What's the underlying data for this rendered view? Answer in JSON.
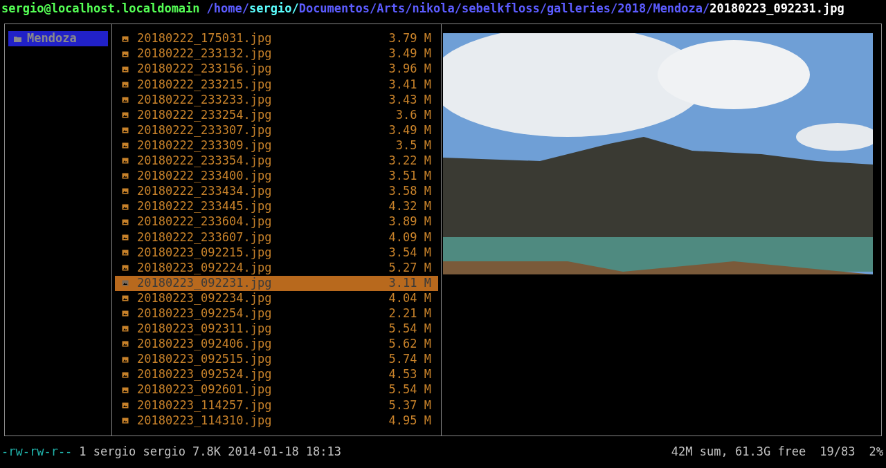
{
  "title_bar": {
    "user_host": "sergio@localhost.localdomain",
    "path": [
      {
        "kind": "dir",
        "text": "/home/"
      },
      {
        "kind": "home",
        "text": "sergio/"
      },
      {
        "kind": "dir",
        "text": "Documentos/Arts/nikola/sebelkfloss/galleries/2018/Mendoza/"
      },
      {
        "kind": "file",
        "text": "20180223_092231.jpg"
      }
    ]
  },
  "parent_column": {
    "items": [
      {
        "name": "Mendoza",
        "selected": true
      }
    ]
  },
  "file_list": {
    "items": [
      {
        "name": "20180222_175031.jpg",
        "size": "3.79 M",
        "selected": false
      },
      {
        "name": "20180222_233132.jpg",
        "size": "3.49 M",
        "selected": false
      },
      {
        "name": "20180222_233156.jpg",
        "size": "3.96 M",
        "selected": false
      },
      {
        "name": "20180222_233215.jpg",
        "size": "3.41 M",
        "selected": false
      },
      {
        "name": "20180222_233233.jpg",
        "size": "3.43 M",
        "selected": false
      },
      {
        "name": "20180222_233254.jpg",
        "size": "3.6 M",
        "selected": false
      },
      {
        "name": "20180222_233307.jpg",
        "size": "3.49 M",
        "selected": false
      },
      {
        "name": "20180222_233309.jpg",
        "size": "3.5 M",
        "selected": false
      },
      {
        "name": "20180222_233354.jpg",
        "size": "3.22 M",
        "selected": false
      },
      {
        "name": "20180222_233400.jpg",
        "size": "3.51 M",
        "selected": false
      },
      {
        "name": "20180222_233434.jpg",
        "size": "3.58 M",
        "selected": false
      },
      {
        "name": "20180222_233445.jpg",
        "size": "4.32 M",
        "selected": false
      },
      {
        "name": "20180222_233604.jpg",
        "size": "3.89 M",
        "selected": false
      },
      {
        "name": "20180222_233607.jpg",
        "size": "4.09 M",
        "selected": false
      },
      {
        "name": "20180223_092215.jpg",
        "size": "3.54 M",
        "selected": false
      },
      {
        "name": "20180223_092224.jpg",
        "size": "5.27 M",
        "selected": false
      },
      {
        "name": "20180223_092231.jpg",
        "size": "3.11 M",
        "selected": true
      },
      {
        "name": "20180223_092234.jpg",
        "size": "4.04 M",
        "selected": false
      },
      {
        "name": "20180223_092254.jpg",
        "size": "2.21 M",
        "selected": false
      },
      {
        "name": "20180223_092311.jpg",
        "size": "5.54 M",
        "selected": false
      },
      {
        "name": "20180223_092406.jpg",
        "size": "5.62 M",
        "selected": false
      },
      {
        "name": "20180223_092515.jpg",
        "size": "5.74 M",
        "selected": false
      },
      {
        "name": "20180223_092524.jpg",
        "size": "4.53 M",
        "selected": false
      },
      {
        "name": "20180223_092601.jpg",
        "size": "5.54 M",
        "selected": false
      },
      {
        "name": "20180223_114257.jpg",
        "size": "5.37 M",
        "selected": false
      },
      {
        "name": "20180223_114310.jpg",
        "size": "4.95 M",
        "selected": false
      }
    ]
  },
  "status_bar": {
    "permissions": "-rw-rw-r--",
    "file_info": "1 sergio sergio 7.8K 2014-01-18 18:13",
    "disk_info": "42M sum, 61.3G free",
    "position": "19/83",
    "scroll": "2%"
  }
}
